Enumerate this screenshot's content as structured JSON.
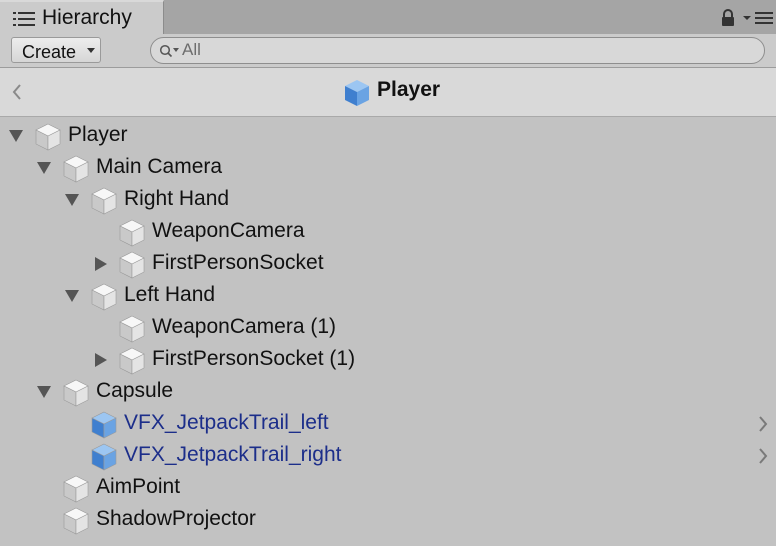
{
  "window": {
    "tab_title": "Hierarchy",
    "icons": {
      "tab": "hierarchy-list-icon",
      "lock": "lock-icon",
      "menu": "menu-icon"
    }
  },
  "toolbar": {
    "create_label": "Create",
    "search": {
      "placeholder": "All",
      "value": ""
    }
  },
  "prefab_header": {
    "title": "Player"
  },
  "colors": {
    "background": "#c2c2c2",
    "tab_bar": "#a5a5a5",
    "header": "#d9d9d9",
    "prefab_blue_text": "#1c2e8a",
    "prefab_blue_cube": "#5a93d6"
  },
  "tree": [
    {
      "label": "Player",
      "depth": 0,
      "arrow": "expanded",
      "icon": "gray-cube",
      "blue": false,
      "chevron": false
    },
    {
      "label": "Main Camera",
      "depth": 1,
      "arrow": "expanded",
      "icon": "gray-cube",
      "blue": false,
      "chevron": false
    },
    {
      "label": "Right Hand",
      "depth": 2,
      "arrow": "expanded",
      "icon": "gray-cube",
      "blue": false,
      "chevron": false
    },
    {
      "label": "WeaponCamera",
      "depth": 3,
      "arrow": "none",
      "icon": "gray-cube",
      "blue": false,
      "chevron": false
    },
    {
      "label": "FirstPersonSocket",
      "depth": 3,
      "arrow": "collapsed",
      "icon": "gray-cube",
      "blue": false,
      "chevron": false
    },
    {
      "label": "Left Hand",
      "depth": 2,
      "arrow": "expanded",
      "icon": "gray-cube",
      "blue": false,
      "chevron": false
    },
    {
      "label": "WeaponCamera (1)",
      "depth": 3,
      "arrow": "none",
      "icon": "gray-cube",
      "blue": false,
      "chevron": false
    },
    {
      "label": "FirstPersonSocket (1)",
      "depth": 3,
      "arrow": "collapsed",
      "icon": "gray-cube",
      "blue": false,
      "chevron": false
    },
    {
      "label": "Capsule",
      "depth": 1,
      "arrow": "expanded",
      "icon": "gray-cube",
      "blue": false,
      "chevron": false
    },
    {
      "label": "VFX_JetpackTrail_left",
      "depth": 2,
      "arrow": "none",
      "icon": "blue-prefab-cube",
      "blue": true,
      "chevron": true
    },
    {
      "label": "VFX_JetpackTrail_right",
      "depth": 2,
      "arrow": "none",
      "icon": "blue-prefab-cube",
      "blue": true,
      "chevron": true
    },
    {
      "label": "AimPoint",
      "depth": 1,
      "arrow": "none",
      "icon": "gray-cube",
      "blue": false,
      "chevron": false
    },
    {
      "label": "ShadowProjector",
      "depth": 1,
      "arrow": "none",
      "icon": "gray-cube",
      "blue": false,
      "chevron": false
    }
  ]
}
